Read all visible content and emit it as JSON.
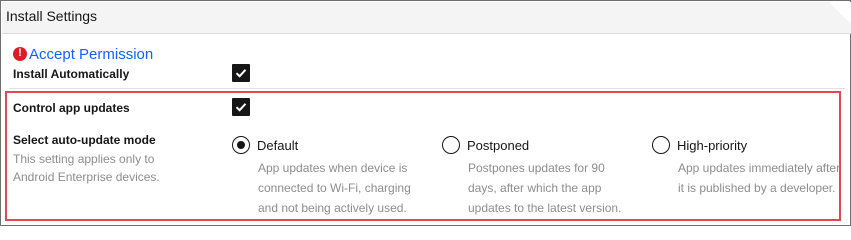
{
  "header": {
    "title": "Install Settings"
  },
  "accept": {
    "error_icon": "!",
    "link_label": "Accept Permission"
  },
  "install_auto": {
    "label": "Install Automatically",
    "checked": true
  },
  "control_updates": {
    "label": "Control app updates",
    "checked": true
  },
  "update_mode": {
    "label": "Select auto-update mode",
    "helper_line1": "This setting applies only to",
    "helper_line2": "Android Enterprise devices.",
    "options": [
      {
        "label": "Default",
        "selected": true,
        "desc1": "App updates when device is",
        "desc2": "connected to Wi-Fi, charging",
        "desc3": "and not being actively used."
      },
      {
        "label": "Postponed",
        "selected": false,
        "desc1": "Postpones updates for 90",
        "desc2": "days, after which the app",
        "desc3": "updates to the latest version."
      },
      {
        "label": "High-priority",
        "selected": false,
        "desc1": "App updates immediately after",
        "desc2": "it is published by a developer.",
        "desc3": ""
      }
    ]
  },
  "colors": {
    "accent": "#0f62fe",
    "error": "#da1e28",
    "highlight": "#e5484d"
  }
}
